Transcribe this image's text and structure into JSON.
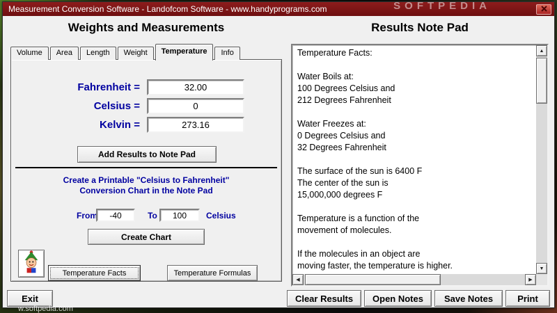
{
  "window": {
    "title": "Measurement Conversion Software - Landofcom Software - www.handyprograms.com"
  },
  "watermarks": {
    "top_right": "SOFTPEDIA",
    "bottom_left": "w.softpedia.com"
  },
  "icons": {
    "scroll_up": "▲",
    "scroll_down": "▼",
    "scroll_left": "◀",
    "scroll_right": "▶"
  },
  "colors": {
    "titlebar": "#7a1212",
    "accent_blue": "#0000a0",
    "panel_bg": "#f0f0f0",
    "close_button_red": "#b02a2a"
  },
  "left_panel": {
    "title": "Weights and Measurements",
    "tabs": [
      {
        "label": "Volume",
        "active": false
      },
      {
        "label": "Area",
        "active": false
      },
      {
        "label": "Length",
        "active": false
      },
      {
        "label": "Weight",
        "active": false
      },
      {
        "label": "Temperature",
        "active": true
      },
      {
        "label": "Info",
        "active": false
      }
    ],
    "fields": [
      {
        "label": "Fahrenheit =",
        "value": "32.00"
      },
      {
        "label": "Celsius =",
        "value": "0"
      },
      {
        "label": "Kelvin =",
        "value": "273.16"
      }
    ],
    "add_results_button": "Add Results to Note Pad",
    "chart_section": {
      "line1": "Create a Printable \"Celsius to Fahrenheit\"",
      "line2": "Conversion Chart in the Note Pad",
      "from_label": "From:",
      "from_value": "-40",
      "to_label": "To",
      "to_value": "100",
      "unit_label": "Celsius",
      "create_chart_button": "Create Chart"
    },
    "facts_button": "Temperature Facts",
    "formulas_button": "Temperature Formulas"
  },
  "right_panel": {
    "title": "Results Note Pad",
    "notepad_lines": [
      "Temperature Facts:",
      "",
      "Water Boils at:",
      "100 Degrees Celsius and",
      "212 Degrees Fahrenheit",
      "",
      "Water Freezes at:",
      "0 Degrees Celsius and",
      "32 Degrees Fahrenheit",
      "",
      "The surface of the sun is 6400 F",
      "The center of the sun is",
      "15,000,000 degrees F",
      "",
      "Temperature is a function of the",
      "movement of molecules.",
      "",
      "If the molecules in an object are",
      "moving faster, the temperature is higher."
    ]
  },
  "bottom_bar": {
    "exit": "Exit",
    "clear_results": "Clear Results",
    "open_notes": "Open Notes",
    "save_notes": "Save Notes",
    "print": "Print"
  }
}
